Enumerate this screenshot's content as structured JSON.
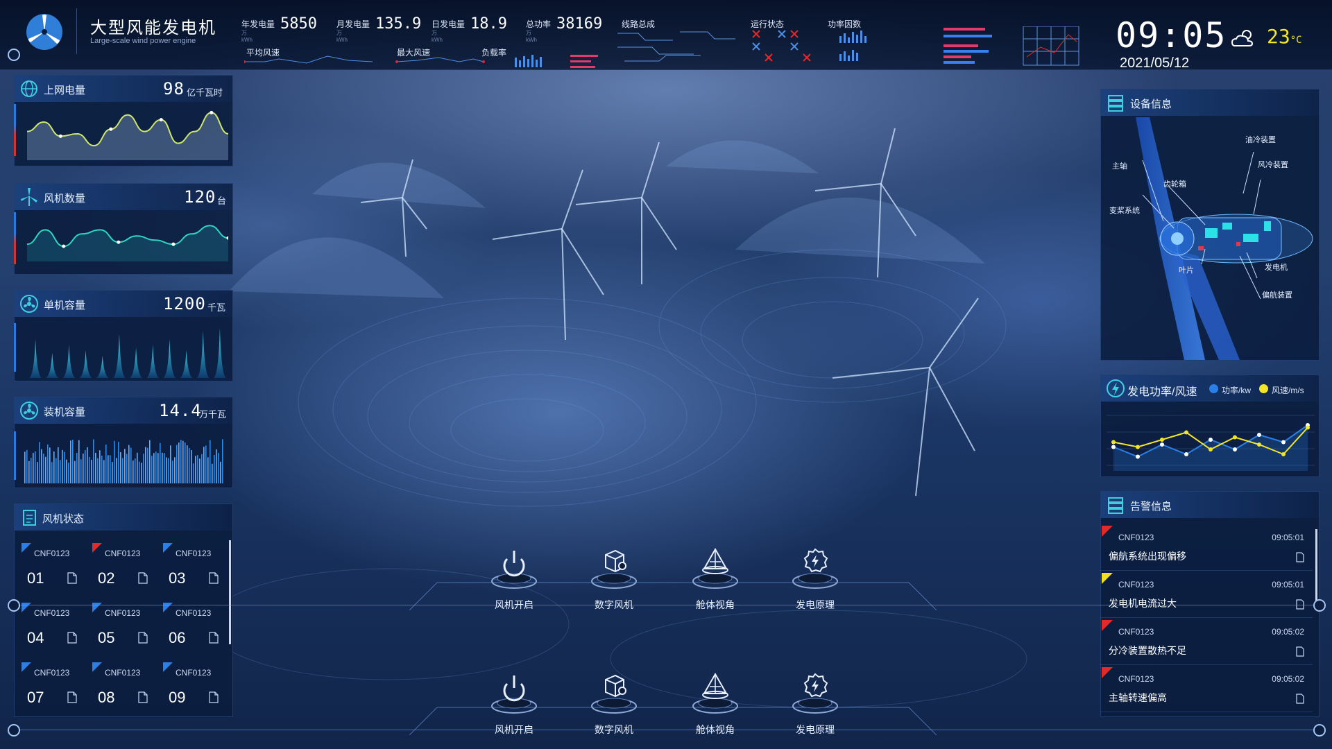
{
  "colors": {
    "accent": "#2a80e8",
    "alert_red": "#e22a2a",
    "alert_yellow": "#f0e020",
    "teal": "#21d6c6",
    "gold": "#f3e62a"
  },
  "header": {
    "title": "大型风能发电机",
    "subtitle": "Large-scale wind power engine",
    "stats": [
      {
        "label": "年发电量",
        "unit": "万kWh",
        "value": "5850"
      },
      {
        "label": "月发电量",
        "unit": "万kWh",
        "value": "135.9"
      },
      {
        "label": "日发电量",
        "unit": "万kWh",
        "value": "18.9"
      },
      {
        "label": "总功率",
        "unit": "万kWh",
        "value": "38169"
      }
    ],
    "sub_labels": [
      "平均风速",
      "最大风速",
      "负载率"
    ],
    "section_labels": [
      "线路总成",
      "运行状态",
      "功率因数"
    ],
    "clock": "09:05",
    "date": "2021/05/12",
    "temperature": "23",
    "temperature_unit": "°C",
    "weather_icon": "cloud-sun-icon"
  },
  "left": {
    "grid_power": {
      "title": "上网电量",
      "value": "98",
      "unit": "亿千瓦时",
      "trend": [
        0.55,
        0.75,
        0.45,
        0.5,
        0.25,
        0.6,
        0.9,
        0.55,
        0.8,
        0.3,
        0.55,
        0.95,
        0.5
      ]
    },
    "turbine_count": {
      "title": "风机数量",
      "value": "120",
      "unit": "台",
      "trend": [
        0.35,
        0.7,
        0.3,
        0.6,
        0.7,
        0.4,
        0.55,
        0.45,
        0.35,
        0.6,
        0.8,
        0.5
      ]
    },
    "unit_capacity": {
      "title": "单机容量",
      "value": "1200",
      "unit": "千瓦",
      "peaks": [
        0.7,
        0.45,
        0.6,
        0.5,
        0.4,
        0.8,
        0.55,
        0.6,
        0.7,
        0.5,
        0.85,
        0.9
      ]
    },
    "installed_capacity": {
      "title": "装机容量",
      "value": "14.4",
      "unit": "万千瓦"
    },
    "turbine_status": {
      "title": "风机状态",
      "cells": [
        {
          "code": "CNF0123",
          "num": "01",
          "flag": "blue"
        },
        {
          "code": "CNF0123",
          "num": "02",
          "flag": "red"
        },
        {
          "code": "CNF0123",
          "num": "03",
          "flag": "blue"
        },
        {
          "code": "CNF0123",
          "num": "04",
          "flag": "blue"
        },
        {
          "code": "CNF0123",
          "num": "05",
          "flag": "blue"
        },
        {
          "code": "CNF0123",
          "num": "06",
          "flag": "blue"
        },
        {
          "code": "CNF0123",
          "num": "07",
          "flag": "blue"
        },
        {
          "code": "CNF0123",
          "num": "08",
          "flag": "blue"
        },
        {
          "code": "CNF0123",
          "num": "09",
          "flag": "blue"
        }
      ]
    }
  },
  "right": {
    "device": {
      "title": "设备信息",
      "callouts": [
        "油冷装置",
        "主轴",
        "风冷装置",
        "齿轮箱",
        "变桨系统",
        "叶片",
        "发电机",
        "偏航装置"
      ]
    },
    "power_wind": {
      "title": "发电功率/风速",
      "legend": [
        {
          "label": "功率/kw",
          "color": "#2a80e8"
        },
        {
          "label": "风速/m/s",
          "color": "#f3e62a"
        }
      ],
      "power": [
        0.35,
        0.15,
        0.4,
        0.2,
        0.5,
        0.3,
        0.6,
        0.45,
        0.8
      ],
      "wind": [
        0.45,
        0.35,
        0.5,
        0.65,
        0.3,
        0.55,
        0.4,
        0.2,
        0.75
      ]
    },
    "alerts": {
      "title": "告警信息",
      "items": [
        {
          "code": "CNF0123",
          "time": "09:05:01",
          "message": "偏航系统出现偏移",
          "level": "red"
        },
        {
          "code": "CNF0123",
          "time": "09:05:01",
          "message": "发电机电流过大",
          "level": "yellow"
        },
        {
          "code": "CNF0123",
          "time": "09:05:02",
          "message": "分冷装置散热不足",
          "level": "red"
        },
        {
          "code": "CNF0123",
          "time": "09:05:02",
          "message": "主轴转速偏高",
          "level": "red"
        }
      ]
    }
  },
  "nav": [
    {
      "label": "风机开启",
      "icon": "power-icon"
    },
    {
      "label": "数字风机",
      "icon": "cube-gear-icon"
    },
    {
      "label": "舱体视角",
      "icon": "pyramid-icon"
    },
    {
      "label": "发电原理",
      "icon": "gear-bolt-icon"
    }
  ]
}
